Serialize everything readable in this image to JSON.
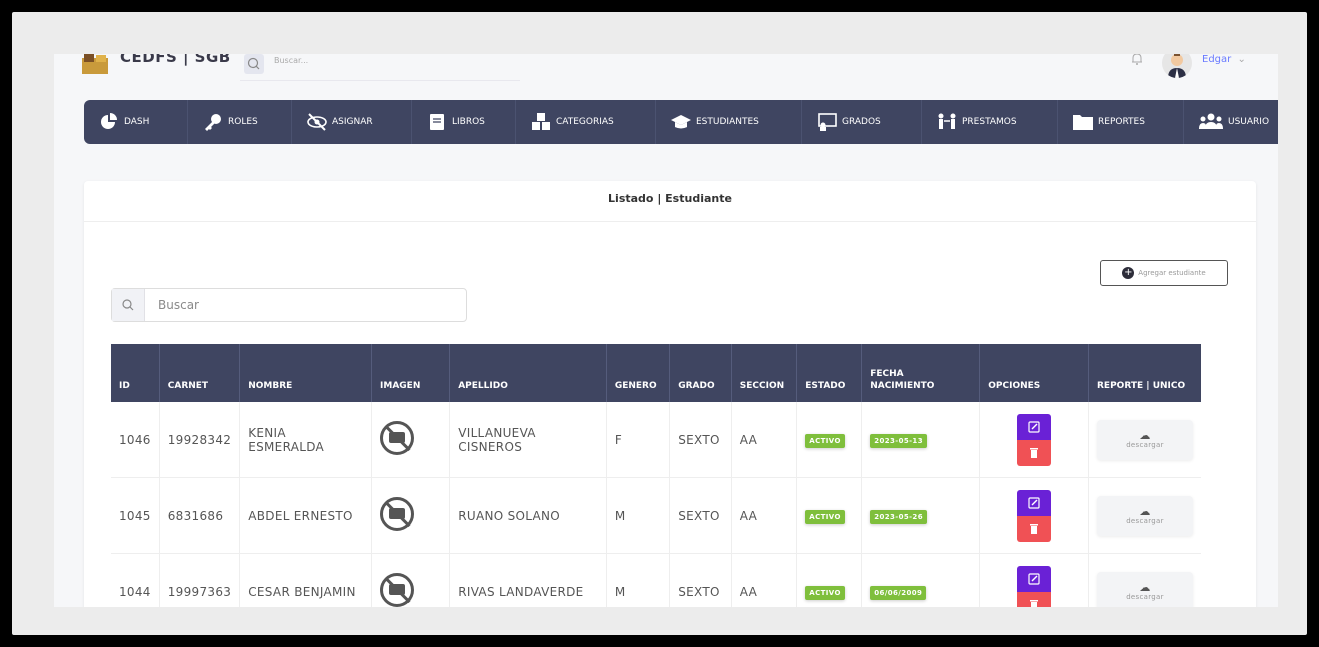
{
  "header": {
    "brand": "CEDFS | SGB",
    "search_placeholder": "Buscar...",
    "user_name": "Edgar",
    "user_caret": "⌄"
  },
  "nav": {
    "items": [
      {
        "label": "DASH",
        "icon": "pie-chart-icon"
      },
      {
        "label": "ROLES",
        "icon": "key-icon"
      },
      {
        "label": "ASIGNAR",
        "icon": "eye-slash-icon"
      },
      {
        "label": "LIBROS",
        "icon": "book-icon"
      },
      {
        "label": "CATEGORIAS",
        "icon": "cubes-icon"
      },
      {
        "label": "ESTUDIANTES",
        "icon": "graduation-cap-icon"
      },
      {
        "label": "GRADOS",
        "icon": "chalkboard-icon"
      },
      {
        "label": "PRESTAMOS",
        "icon": "people-exchange-icon"
      },
      {
        "label": "REPORTES",
        "icon": "folder-icon"
      },
      {
        "label": "USUARIO",
        "icon": "users-icon"
      }
    ]
  },
  "panel": {
    "title": "Listado | Estudiante",
    "add_button_label": "Agregar estudiante",
    "search_placeholder": "Buscar"
  },
  "table": {
    "headers": {
      "id": "ID",
      "carnet": "CARNET",
      "nombre": "NOMBRE",
      "imagen": "IMAGEN",
      "apellido": "APELLIDO",
      "genero": "GENERO",
      "grado": "GRADO",
      "seccion": "SECCION",
      "estado": "ESTADO",
      "fecha_1": "FECHA",
      "fecha_2": "NACIMIENTO",
      "opciones": "OPCIONES",
      "reporte": "REPORTE | UNICO"
    },
    "download_label": "descargar",
    "rows": [
      {
        "id": "1046",
        "carnet": "19928342",
        "nombre": "KENIA ESMERALDA",
        "apellido": "VILLANUEVA CISNEROS",
        "genero": "F",
        "grado": "SEXTO",
        "seccion": "AA",
        "estado": "ACTIVO",
        "fecha": "2023-05-13"
      },
      {
        "id": "1045",
        "carnet": "6831686",
        "nombre": "ABDEL ERNESTO",
        "apellido": "RUANO SOLANO",
        "genero": "M",
        "grado": "SEXTO",
        "seccion": "AA",
        "estado": "ACTIVO",
        "fecha": "2023-05-26"
      },
      {
        "id": "1044",
        "carnet": "19997363",
        "nombre": "CESAR BENJAMIN",
        "apellido": "RIVAS LANDAVERDE",
        "genero": "M",
        "grado": "SEXTO",
        "seccion": "AA",
        "estado": "ACTIVO",
        "fecha": "06/06/2009"
      }
    ]
  },
  "colors": {
    "nav_bg": "#3f4561",
    "accent_purple": "#6a21d6",
    "danger_red": "#f05155",
    "badge_green": "#7fbf3c",
    "user_link": "#6a7bff"
  }
}
